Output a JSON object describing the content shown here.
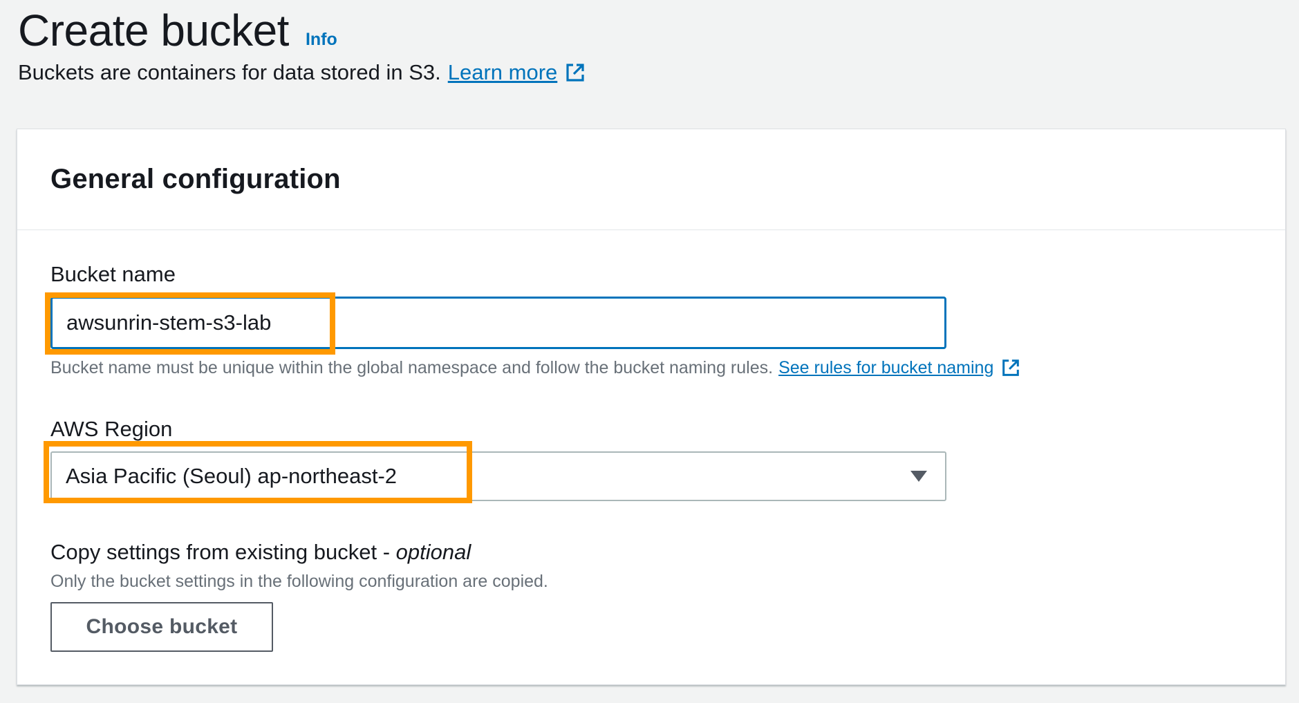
{
  "header": {
    "title": "Create bucket",
    "info_link": "Info",
    "description": "Buckets are containers for data stored in S3.",
    "learn_more_link": "Learn more"
  },
  "panel": {
    "title": "General configuration",
    "bucket_name": {
      "label": "Bucket name",
      "value": "awsunrin-stem-s3-lab",
      "hint": "Bucket name must be unique within the global namespace and follow the bucket naming rules.",
      "rules_link": "See rules for bucket naming"
    },
    "region": {
      "label": "AWS Region",
      "selected": "Asia Pacific (Seoul) ap-northeast-2"
    },
    "copy_settings": {
      "label": "Copy settings from existing bucket -",
      "optional": "optional",
      "hint": "Only the bucket settings in the following configuration are copied.",
      "button": "Choose bucket"
    }
  },
  "colors": {
    "link": "#0073bb",
    "highlight": "#ff9900",
    "background": "#f2f3f3"
  },
  "icons": [
    "external-link-icon",
    "caret-down-icon"
  ]
}
